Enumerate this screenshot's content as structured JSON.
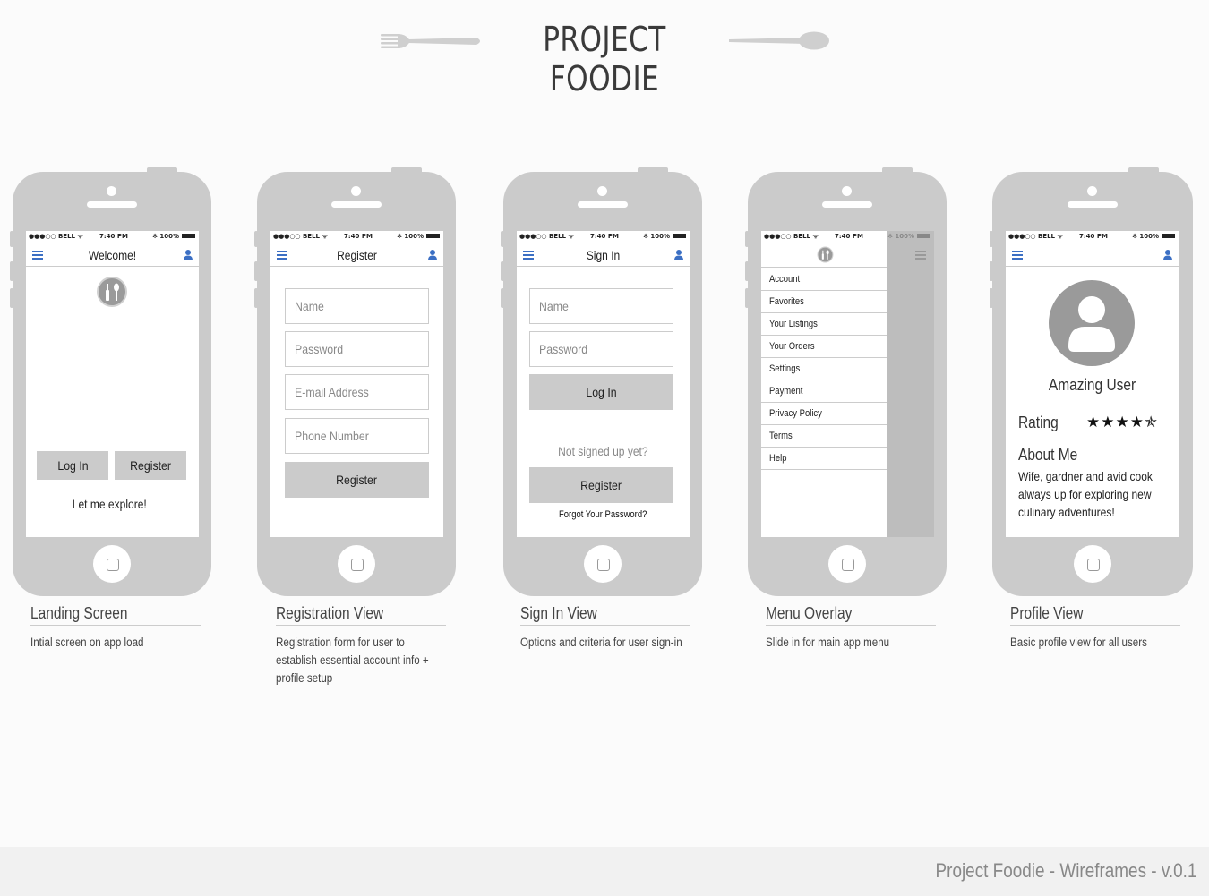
{
  "header": {
    "title": "PROJECT FOODIE"
  },
  "status": {
    "carrier": "●●●○○ BELL ᯤ",
    "time": "7:40 PM",
    "battery": "✻ 100%"
  },
  "landing": {
    "nav_title": "Welcome!",
    "login_label": "Log In",
    "register_label": "Register",
    "explore_label": "Let me explore!"
  },
  "registration": {
    "nav_title": "Register",
    "fields": [
      "Name",
      "Password",
      "E-mail Address",
      "Phone Number"
    ],
    "register_label": "Register"
  },
  "signin": {
    "nav_title": "Sign In",
    "fields": [
      "Name",
      "Password"
    ],
    "login_label": "Log In",
    "not_signed_up": "Not signed up yet?",
    "register_label": "Register",
    "forgot_label": "Forgot Your Password?"
  },
  "menu": {
    "items": [
      "Account",
      "Favorites",
      "Your Listings",
      "Your Orders",
      "Settings",
      "Payment",
      "Privacy Policy",
      "Terms",
      "Help"
    ]
  },
  "profile": {
    "user_name": "Amazing User",
    "rating_label": "Rating",
    "rating_stars": "★★★★✯",
    "about_title": "About Me",
    "about_text": "Wife, gardner and avid cook always up for exploring new culinary adventures!"
  },
  "captions": [
    {
      "title": "Landing Screen",
      "desc": "Intial screen on app load"
    },
    {
      "title": "Registration View",
      "desc": "Registration form for user to establish essential account info + profile setup"
    },
    {
      "title": "Sign In View",
      "desc": "Options and criteria for user sign-in"
    },
    {
      "title": "Menu Overlay",
      "desc": "Slide in for main app menu"
    },
    {
      "title": "Profile View",
      "desc": "Basic profile view for all users"
    }
  ],
  "footer": {
    "text": "Project Foodie - Wireframes - v.0.1"
  },
  "colors": {
    "accent_blue": "#3b6fc4",
    "frame_grey": "#cbcbcb"
  }
}
